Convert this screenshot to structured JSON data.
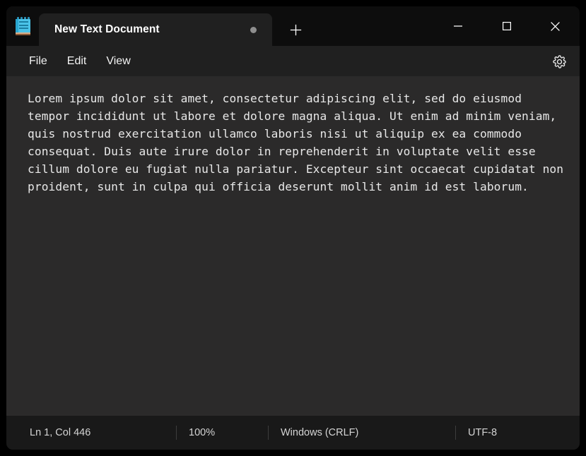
{
  "window": {
    "app_name": "Notepad",
    "app_icon": "notepad-icon",
    "bg_color": "#0d0d0d",
    "tab_color": "#202020",
    "editor_bg": "#2b2a2a",
    "status_bg": "#191919",
    "accent_icon_color": "#4bc3e8"
  },
  "titlebar": {
    "tabs": [
      {
        "label": "New Text Document",
        "modified": true,
        "modified_indicator": "unsaved-dot",
        "active": true
      }
    ],
    "new_tab_label": "+",
    "new_tab_name": "add-tab-icon",
    "controls": {
      "minimize": "minimize-icon",
      "maximize": "maximize-icon",
      "close": "close-icon"
    }
  },
  "menubar": {
    "items": [
      {
        "label": "File"
      },
      {
        "label": "Edit"
      },
      {
        "label": "View"
      }
    ],
    "settings_icon": "gear-icon"
  },
  "editor": {
    "content": "Lorem ipsum dolor sit amet, consectetur adipiscing elit, sed do eiusmod tempor incididunt ut labore et dolore magna aliqua. Ut enim ad minim veniam, quis nostrud exercitation ullamco laboris nisi ut aliquip ex ea commodo consequat. Duis aute irure dolor in reprehenderit in voluptate velit esse cillum dolore eu fugiat nulla pariatur. Excepteur sint occaecat cupidatat non proident, sunt in culpa qui officia deserunt mollit anim id est laborum."
  },
  "statusbar": {
    "position": "Ln 1, Col 446",
    "zoom": "100%",
    "line_ending": "Windows (CRLF)",
    "encoding": "UTF-8"
  }
}
